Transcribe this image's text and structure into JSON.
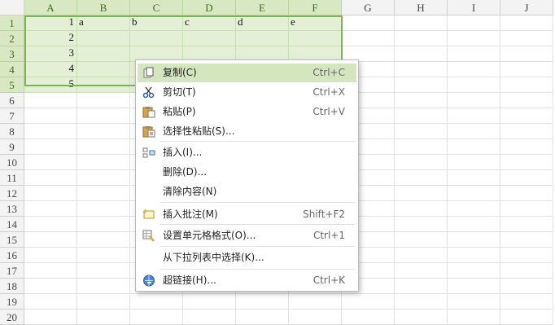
{
  "columns": [
    "A",
    "B",
    "C",
    "D",
    "E",
    "F",
    "G",
    "H",
    "I",
    "J"
  ],
  "selected_columns": [
    "A",
    "B",
    "C",
    "D",
    "E",
    "F"
  ],
  "rows": [
    "1",
    "2",
    "3",
    "4",
    "5",
    "6",
    "7",
    "8",
    "9",
    "10",
    "11",
    "12",
    "13",
    "14",
    "15",
    "16",
    "17",
    "18",
    "19",
    "20"
  ],
  "selected_rows": [
    "1",
    "2",
    "3",
    "4",
    "5"
  ],
  "cells": [
    {
      "col": "A",
      "row": "1",
      "value": "1",
      "kind": "num"
    },
    {
      "col": "B",
      "row": "1",
      "value": "a",
      "kind": "txt"
    },
    {
      "col": "C",
      "row": "1",
      "value": "b",
      "kind": "txt"
    },
    {
      "col": "D",
      "row": "1",
      "value": "c",
      "kind": "txt"
    },
    {
      "col": "E",
      "row": "1",
      "value": "d",
      "kind": "txt"
    },
    {
      "col": "F",
      "row": "1",
      "value": "e",
      "kind": "txt"
    },
    {
      "col": "A",
      "row": "2",
      "value": "2",
      "kind": "num"
    },
    {
      "col": "A",
      "row": "3",
      "value": "3",
      "kind": "num"
    },
    {
      "col": "A",
      "row": "4",
      "value": "4",
      "kind": "num"
    },
    {
      "col": "A",
      "row": "5",
      "value": "5",
      "kind": "num"
    }
  ],
  "context_menu": {
    "items": [
      {
        "icon": "copy-icon",
        "label": "复制(C)",
        "shortcut": "Ctrl+C",
        "highlighted": true
      },
      {
        "icon": "scissors-icon",
        "label": "剪切(T)",
        "shortcut": "Ctrl+X"
      },
      {
        "icon": "paste-icon",
        "label": "粘贴(P)",
        "shortcut": "Ctrl+V"
      },
      {
        "icon": "paste-special-icon",
        "label": "选择性粘贴(S)...",
        "shortcut": ""
      },
      {
        "icon": "insert-icon",
        "label": "插入(I)...",
        "shortcut": ""
      },
      {
        "icon": "",
        "label": "删除(D)...",
        "shortcut": ""
      },
      {
        "icon": "",
        "label": "清除内容(N)",
        "shortcut": ""
      },
      {
        "icon": "comment-icon",
        "label": "插入批注(M)",
        "shortcut": "Shift+F2"
      },
      {
        "icon": "format-cells-icon",
        "label": "设置单元格格式(O)...",
        "shortcut": "Ctrl+1"
      },
      {
        "icon": "",
        "label": "从下拉列表中选择(K)...",
        "shortcut": ""
      },
      {
        "icon": "hyperlink-icon",
        "label": "超链接(H)...",
        "shortcut": "Ctrl+K"
      }
    ]
  },
  "colors": {
    "selection_accent": "#7fb456",
    "highlight": "#d3e6bd"
  }
}
